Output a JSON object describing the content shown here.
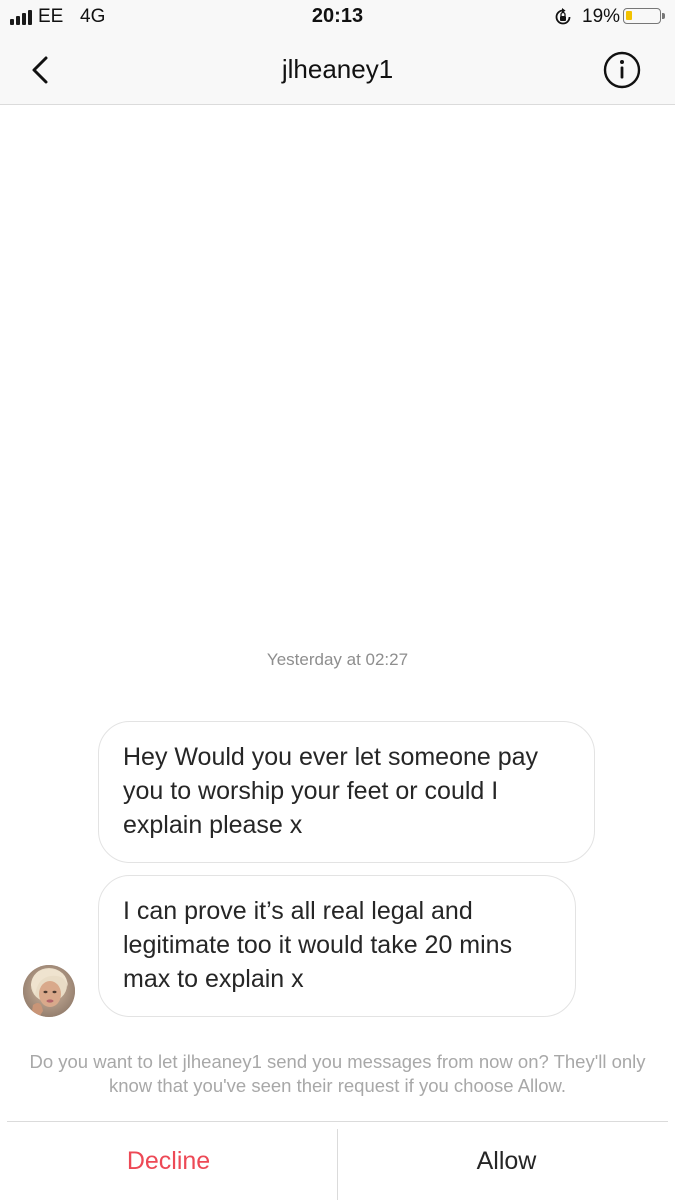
{
  "status_bar": {
    "carrier": "EE",
    "network": "4G",
    "time": "20:13",
    "battery_percent_label": "19%",
    "battery_level": 0.19,
    "battery_color": "#f2c200"
  },
  "header": {
    "title": "jlheaney1",
    "back_icon": "chevron-left-icon",
    "info_icon": "info-icon"
  },
  "conversation": {
    "timestamp": "Yesterday at 02:27",
    "messages": [
      {
        "text": "Hey Would you ever let someone pay you to worship your feet or could I explain please x"
      },
      {
        "text": "I can prove it’s all real legal and legitimate too it would take 20 mins max to explain x"
      }
    ]
  },
  "request": {
    "prompt": "Do you want to let jlheaney1 send you messages from now on? They'll only know that you've seen their request if you choose Allow."
  },
  "actions": {
    "decline_label": "Decline",
    "allow_label": "Allow",
    "decline_color": "#ed4956"
  }
}
